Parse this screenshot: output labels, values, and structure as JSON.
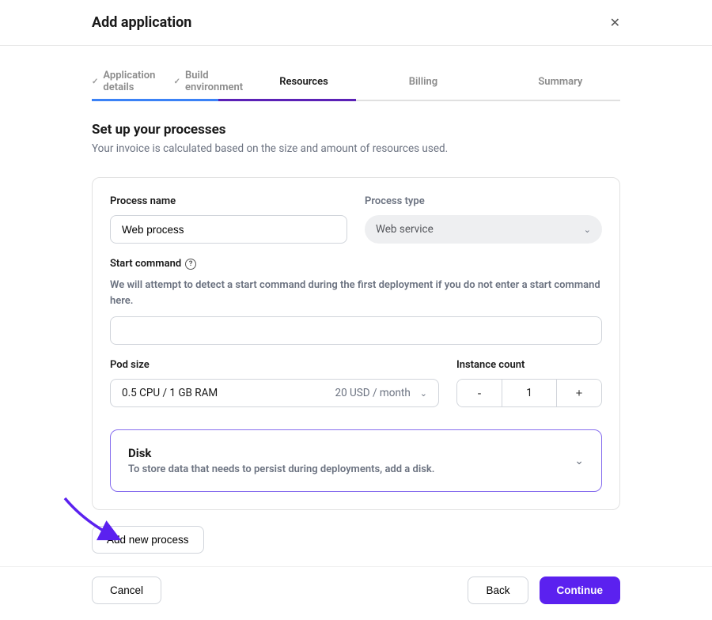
{
  "header": {
    "title": "Add application"
  },
  "stepper": {
    "items": [
      {
        "label": "Application details",
        "state": "completed"
      },
      {
        "label": "Build environment",
        "state": "completed"
      },
      {
        "label": "Resources",
        "state": "active"
      },
      {
        "label": "Billing",
        "state": "upcoming"
      },
      {
        "label": "Summary",
        "state": "upcoming"
      }
    ]
  },
  "section": {
    "title": "Set up your processes",
    "subtitle": "Your invoice is calculated based on the size and amount of resources used."
  },
  "process": {
    "name_label": "Process name",
    "name_value": "Web process",
    "type_label": "Process type",
    "type_value": "Web service",
    "start_command_label": "Start command",
    "start_command_hint": "We will attempt to detect a start command during the first deployment if you do not enter a start command here.",
    "start_command_value": "",
    "pod_size_label": "Pod size",
    "pod_size_value": "0.5 CPU / 1 GB RAM",
    "pod_size_price": "20 USD / month",
    "instance_count_label": "Instance count",
    "instance_count_value": "1",
    "disk": {
      "title": "Disk",
      "description": "To store data that needs to persist during deployments, add a disk."
    }
  },
  "buttons": {
    "add_process": "Add new process",
    "cancel": "Cancel",
    "back": "Back",
    "continue": "Continue"
  }
}
